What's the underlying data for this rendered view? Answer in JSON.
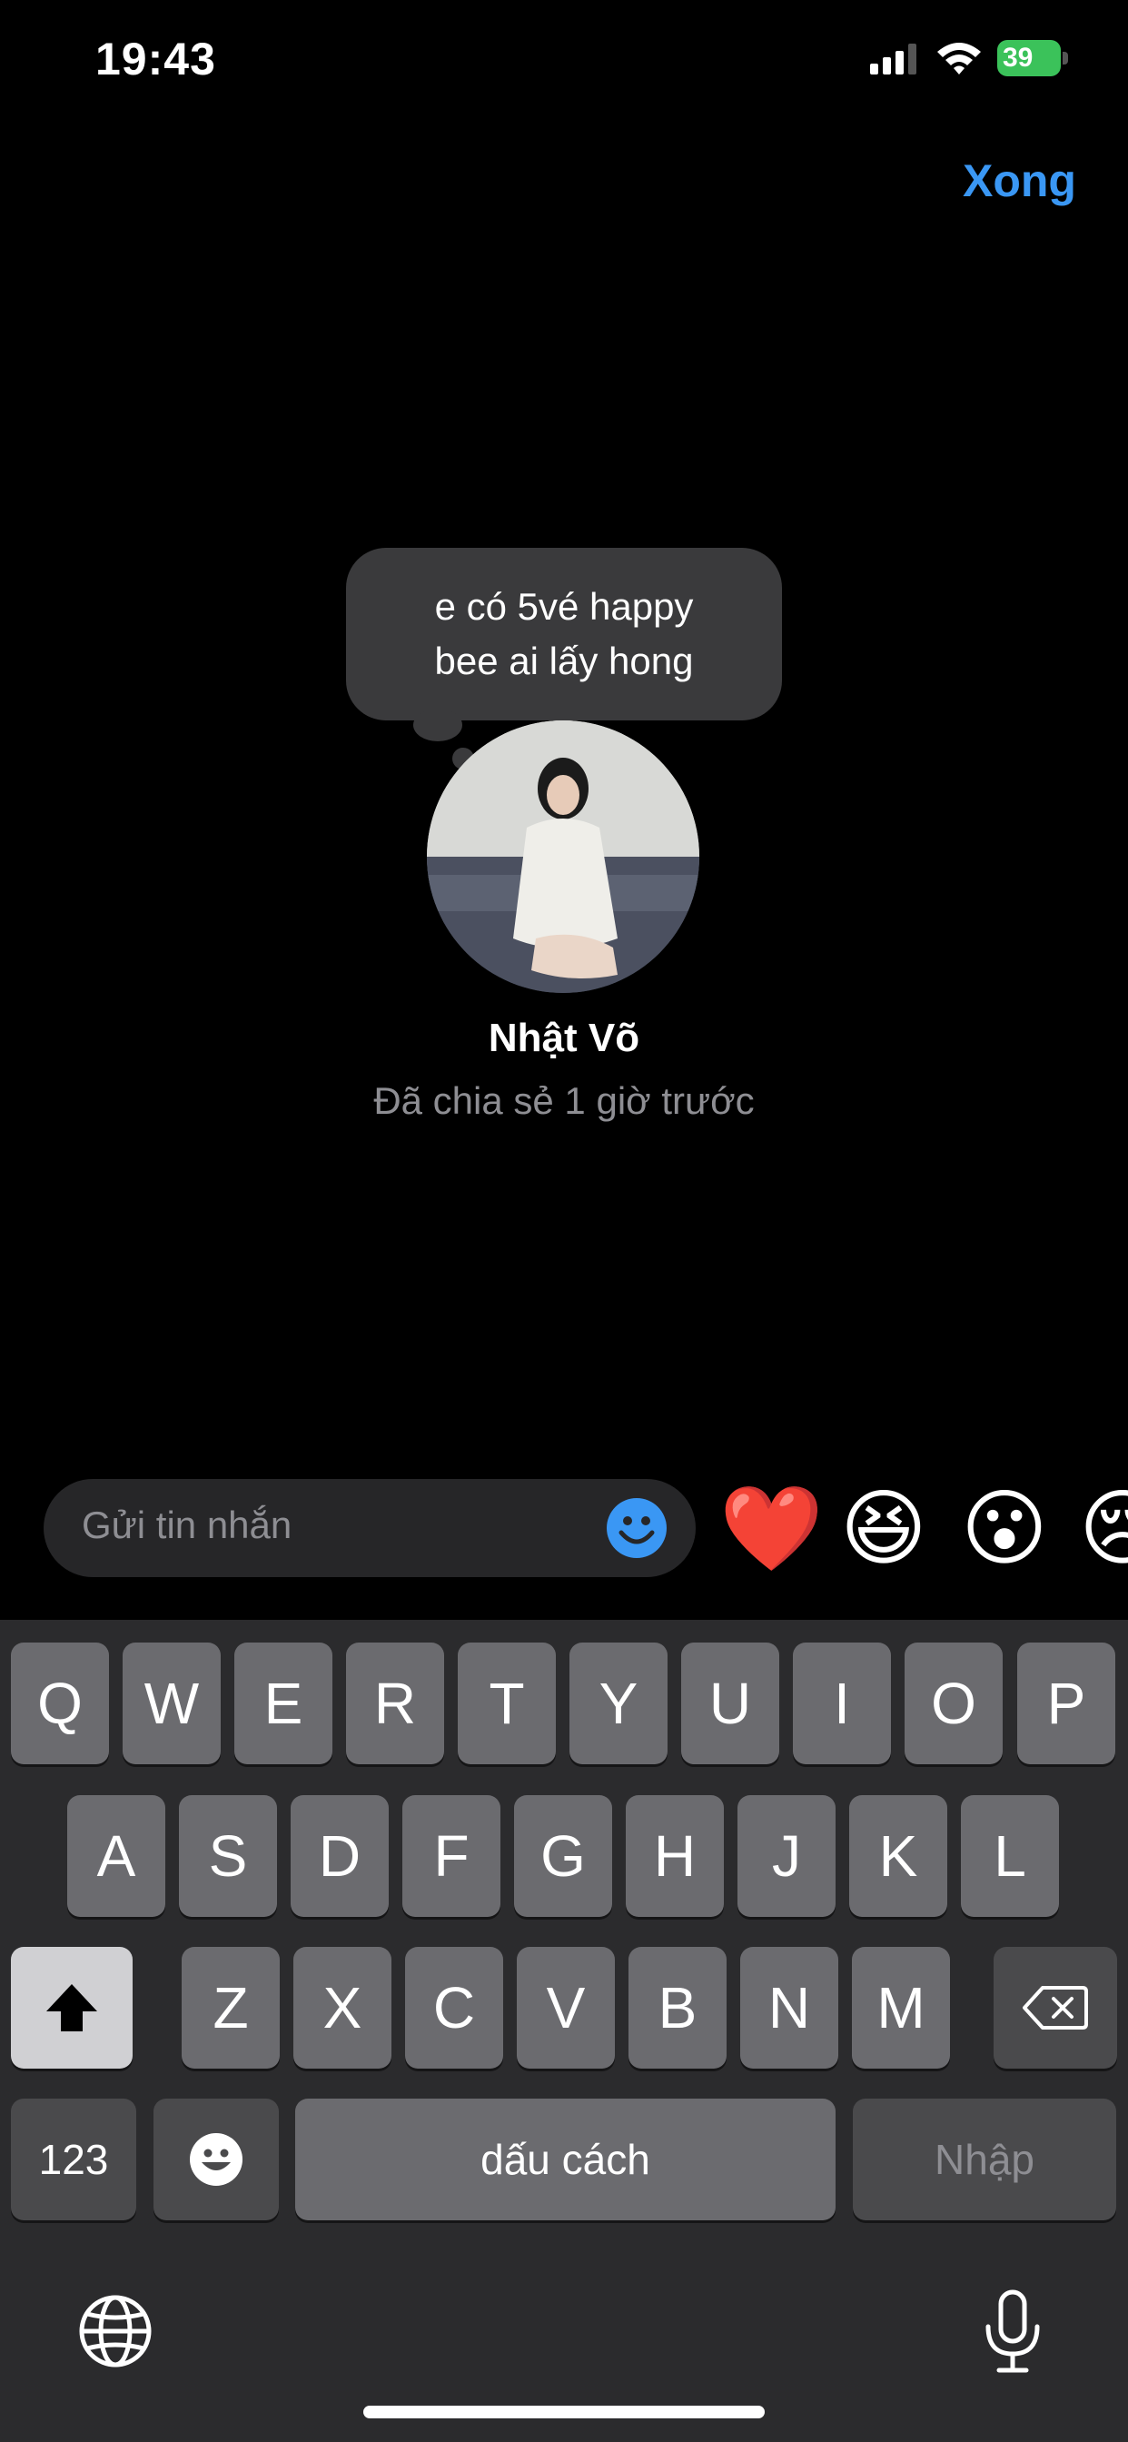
{
  "status_bar": {
    "time": "19:43",
    "battery_level": "39",
    "signal_icon": "signal-icon",
    "wifi_icon": "wifi-icon",
    "battery_icon": "battery-charging-icon"
  },
  "header": {
    "done_label": "Xong"
  },
  "note": {
    "text": "e có 5vé happy\nbee ai lấy hong"
  },
  "profile": {
    "name": "Nhật Võ",
    "shared_time": "Đã chia sẻ 1 giờ trước"
  },
  "message_bar": {
    "placeholder": "Gửi tin nhắn",
    "emoji_icon": "smiley-icon"
  },
  "reactions": [
    "❤️",
    "😆",
    "😮",
    "😢"
  ],
  "keyboard": {
    "row1": [
      "Q",
      "W",
      "E",
      "R",
      "T",
      "Y",
      "U",
      "I",
      "O",
      "P"
    ],
    "row2": [
      "A",
      "S",
      "D",
      "F",
      "G",
      "H",
      "J",
      "K",
      "L"
    ],
    "row3": [
      "Z",
      "X",
      "C",
      "V",
      "B",
      "N",
      "M"
    ],
    "numbers_label": "123",
    "space_label": "dấu cách",
    "return_label": "Nhập",
    "shift_icon": "shift-icon",
    "delete_icon": "backspace-icon",
    "emoji_key_icon": "emoji-keyboard-icon",
    "globe_icon": "globe-icon",
    "mic_icon": "microphone-icon"
  },
  "colors": {
    "accent": "#3a97f4",
    "battery": "#3bc25a",
    "background": "#000000",
    "keyboard": "#2b2b2d"
  }
}
